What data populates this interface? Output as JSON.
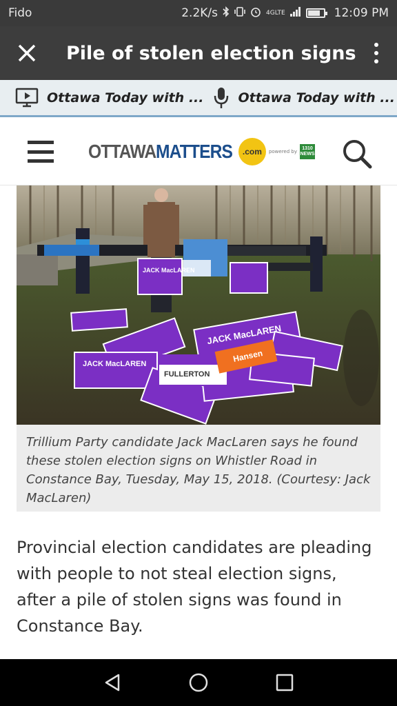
{
  "status_bar": {
    "carrier": "Fido",
    "net_speed": "2.2K/s",
    "network_label": "4GLTE",
    "time": "12:09 PM",
    "icons": [
      "bluetooth-icon",
      "vibrate-icon",
      "alarm-icon",
      "signal-icon",
      "battery-icon"
    ]
  },
  "app_bar": {
    "title": "Pile of stolen election signs...",
    "close_icon": "close-icon",
    "menu_icon": "more-vert-icon"
  },
  "audio_bar": {
    "items": [
      {
        "label": "Ottawa Today with ...",
        "icon": "tv-play-icon"
      },
      {
        "label": "Ottawa Today with ...",
        "icon": "microphone-icon"
      }
    ]
  },
  "site_header": {
    "logo_ottawa": "OTTAWA",
    "logo_matters": "MATTERS",
    "logo_dotcom": ".com",
    "powered_by": "powered by",
    "news_badge_top": "1310",
    "news_badge_bottom": "NEWS",
    "menu_icon": "hamburger-menu-icon",
    "search_icon": "search-icon"
  },
  "article": {
    "photo_signs": [
      "JACK MacLAREN",
      "FULLERTON",
      "Hansen"
    ],
    "caption": "Trillium Party candidate Jack MacLaren says he found these stolen election signs on Whistler Road in Constance Bay, Tuesday, May 15, 2018. (Courtesy: Jack MacLaren)",
    "body": "Provincial election candidates are pleading with people to not steal election signs, after a pile of stolen signs was found in Constance Bay."
  },
  "nav_bar": {
    "icons": [
      "back-icon",
      "home-icon",
      "recents-icon"
    ]
  },
  "colors": {
    "app_bar": "#3d3d3d",
    "brand_blue": "#1c4e8c",
    "brand_yellow": "#f2c413",
    "sign_purple": "#7b2fc4"
  }
}
